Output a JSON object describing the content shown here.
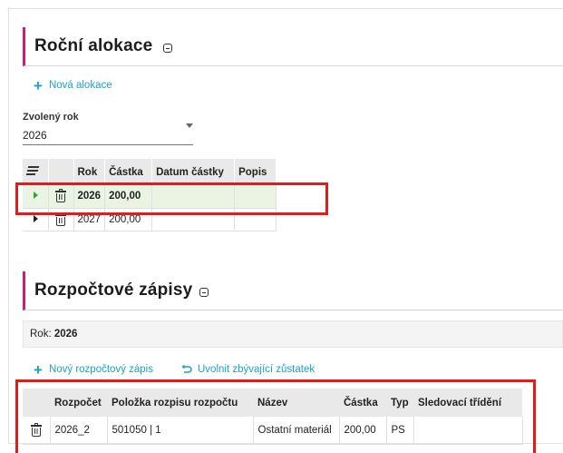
{
  "annual": {
    "title": "Roční alokace",
    "new_link": "Nová alokace",
    "year_label": "Zvolený rok",
    "year_value": "2026",
    "columns": [
      "Rok",
      "Částka",
      "Datum částky",
      "Popis"
    ],
    "rows": [
      {
        "rok": "2026",
        "castka": "200,00",
        "datum": "",
        "popis": "",
        "selected": true
      },
      {
        "rok": "2027",
        "castka": "200,00",
        "datum": "",
        "popis": "",
        "selected": false
      }
    ]
  },
  "budget": {
    "title": "Rozpočtové zápisy",
    "info_label": "Rok:",
    "info_value": "2026",
    "new_link": "Nový rozpočtový zápis",
    "release_link": "Uvolnit zbývající zůstatek",
    "columns": [
      "Rozpočet",
      "Položka rozpisu rozpočtu",
      "Název",
      "Částka",
      "Typ",
      "Sledovací třídění"
    ],
    "rows": [
      {
        "rozpocet": "2026_2",
        "polozka": "501050 | 1",
        "nazev": "Ostatní materiál",
        "castka": "200,00",
        "typ": "PS",
        "sledovaci": ""
      }
    ]
  },
  "icons": {
    "collapse": "collapse-icon",
    "plus": "plus-icon",
    "undo": "undo-icon",
    "trash": "trash-icon",
    "menu": "menu-icon",
    "expand_row": "chevron-right-icon"
  },
  "colors": {
    "accent": "#d6187a",
    "link": "#1ba3c6",
    "highlight": "#e21b1b",
    "selected_row": "#eaf4e3"
  }
}
